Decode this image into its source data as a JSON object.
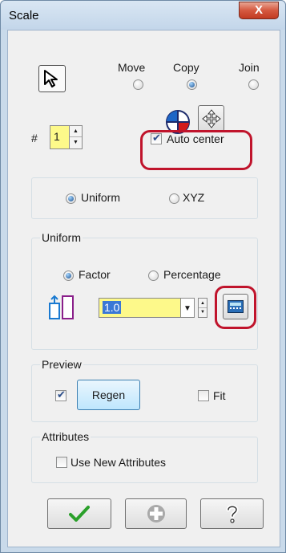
{
  "window": {
    "title": "Scale",
    "close_symbol": "X"
  },
  "mode": {
    "options": [
      "Move",
      "Copy",
      "Join"
    ],
    "selected": "Copy"
  },
  "count": {
    "label": "#",
    "value": "1"
  },
  "auto_center": {
    "label": "Auto center",
    "checked": true
  },
  "scale_type": {
    "options": [
      "Uniform",
      "XYZ"
    ],
    "selected": "Uniform"
  },
  "uniform": {
    "title": "Uniform",
    "options": [
      "Factor",
      "Percentage"
    ],
    "selected": "Factor",
    "value": "1.0"
  },
  "preview": {
    "title": "Preview",
    "regen_label": "Regen",
    "regen_checked": true,
    "fit_label": "Fit",
    "fit_checked": false
  },
  "attributes": {
    "title": "Attributes",
    "use_new_label": "Use New Attributes",
    "checked": false
  },
  "colors": {
    "highlight_ring": "#c0142c",
    "input_fill": "#fdf98a",
    "ok_green": "#2aa02a"
  },
  "icons": {
    "select": "cursor-arrow-icon",
    "center": "center-pie-icon",
    "move": "move-arrows-icon",
    "scale": "scale-shape-icon",
    "calculator": "calculator-icon",
    "ok": "checkmark-icon",
    "apply": "plus-circle-icon",
    "help": "question-mark-icon"
  }
}
